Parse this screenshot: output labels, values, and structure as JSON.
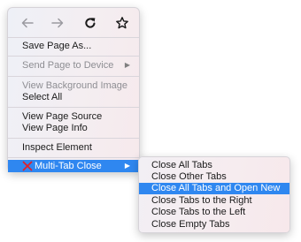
{
  "menu": {
    "nav": {
      "back_icon": "arrow-left-icon",
      "forward_icon": "arrow-right-icon",
      "reload_icon": "reload-icon",
      "bookmark_icon": "star-icon"
    },
    "items": [
      {
        "label": "Save Page As...",
        "enabled": true
      },
      {
        "label": "Send Page to Device",
        "enabled": false,
        "submenu": true
      },
      {
        "label": "View Background Image",
        "enabled": false
      },
      {
        "label": "Select All",
        "enabled": true
      },
      {
        "label": "View Page Source",
        "enabled": true
      },
      {
        "label": "View Page Info",
        "enabled": true
      },
      {
        "label": "Inspect Element",
        "enabled": true
      },
      {
        "label": "Multi-Tab Close",
        "enabled": true,
        "submenu": true,
        "highlighted": true,
        "icon": "red-x-icon"
      }
    ],
    "highlight_color": "#2f87f0"
  },
  "submenu": {
    "items": [
      {
        "label": "Close All Tabs"
      },
      {
        "label": "Close Other Tabs"
      },
      {
        "label": "Close All Tabs and Open New",
        "highlighted": true
      },
      {
        "label": "Close Tabs to the Right"
      },
      {
        "label": "Close Tabs to the Left"
      },
      {
        "label": "Close Empty Tabs"
      }
    ]
  }
}
